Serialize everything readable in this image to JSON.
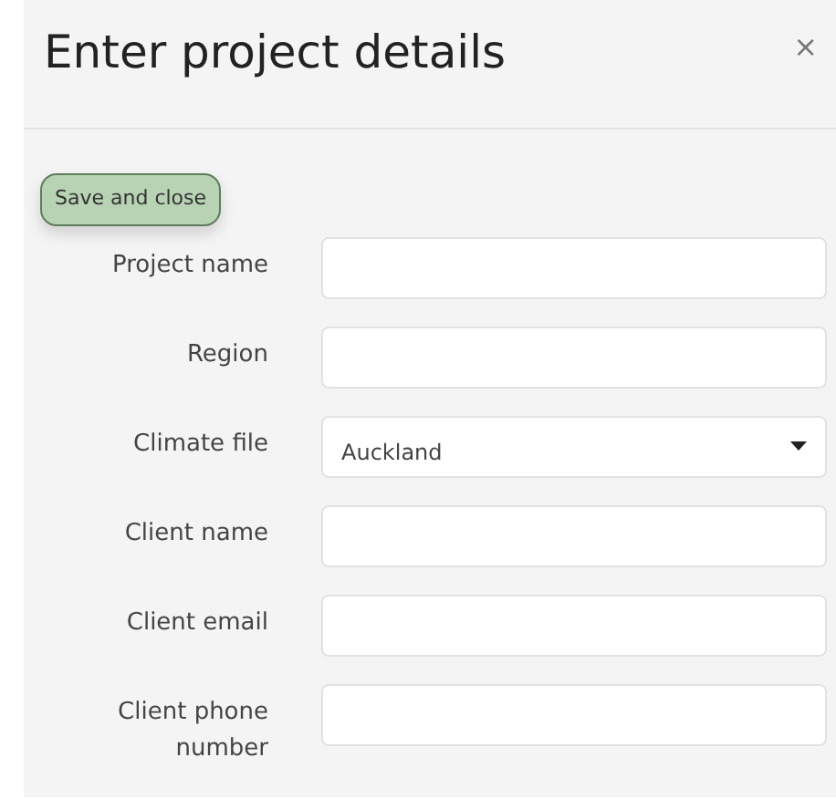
{
  "dialog": {
    "title": "Enter project details",
    "close": "×"
  },
  "save_button": "Save and close",
  "fields": [
    {
      "label": "Project name",
      "kind": "text"
    },
    {
      "label": "Region",
      "kind": "text"
    },
    {
      "label": "Climate file",
      "kind": "select",
      "value": "Auckland"
    },
    {
      "label": "Client name",
      "kind": "text"
    },
    {
      "label": "Client email",
      "kind": "text"
    },
    {
      "label": "Client phone number",
      "kind": "text"
    }
  ]
}
